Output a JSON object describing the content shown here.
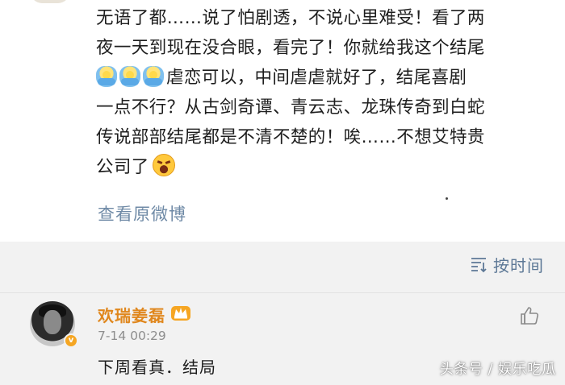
{
  "post": {
    "lines": [
      "无语了都……说了怕剧透，不说心里难受！看了两",
      "夜一天到现在没合眼，看完了！你就给我这个结尾",
      "虐恋可以，中间虐虐就好了，结尾喜剧",
      "一点不行？从古剑奇谭、青云志、龙珠传奇到白蛇",
      "传说部部结尾都是不清不楚的！唉……不想艾特贵",
      "公司了"
    ],
    "view_original": "查看原微博"
  },
  "comments_header": {
    "sort_label": "按时间"
  },
  "comment": {
    "username": "欢瑞姜磊",
    "timestamp": "7-14 00:29",
    "text": "下周看真．结局",
    "verified_badge": "v"
  },
  "watermark": "头条号 / 娱乐吃瓜",
  "icons": {
    "shrug": "shrug-emoji-icon",
    "angry": "angry-emoji-icon",
    "sort": "sort-lines-icon",
    "crown": "crown-badge-icon",
    "like": "thumbs-up-icon"
  },
  "colors": {
    "link": "#6f8aa6",
    "username": "#e0871d",
    "comments_bg": "#f2f2f2",
    "timestamp": "#8e8e8e"
  }
}
